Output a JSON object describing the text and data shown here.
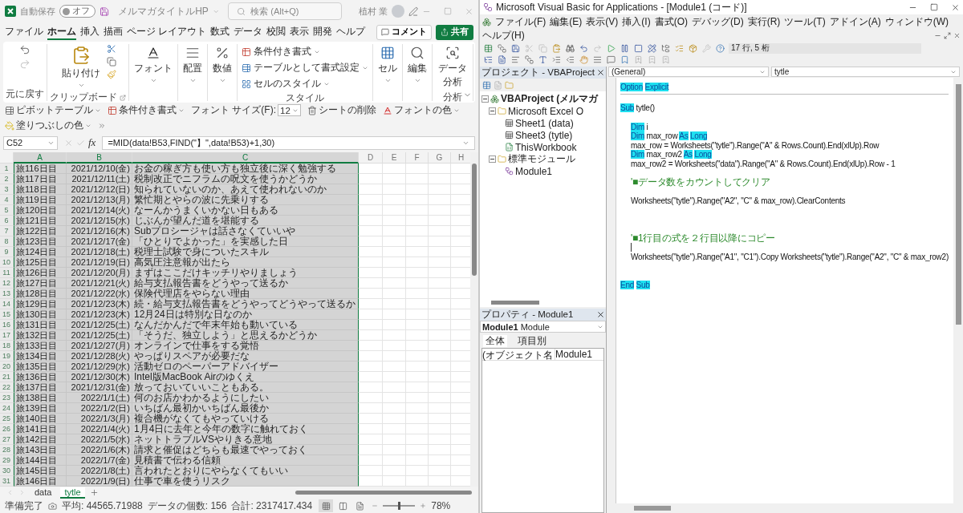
{
  "excel": {
    "title_bar": {
      "autosave_label": "自動保存",
      "autosave_toggle": {
        "label": "オフ",
        "on": false
      },
      "file_name": "メルマガタイトルHP",
      "search": {
        "placeholder": "検索 (Alt+Q)"
      },
      "user_name": "植村 業"
    },
    "ribbon_tabs": [
      {
        "label": "ファイル",
        "selected": false
      },
      {
        "label": "ホーム",
        "selected": true
      },
      {
        "label": "挿入",
        "selected": false
      },
      {
        "label": "描画",
        "selected": false
      },
      {
        "label": "ページ レイアウト",
        "selected": false
      },
      {
        "label": "数式",
        "selected": false
      },
      {
        "label": "データ",
        "selected": false
      },
      {
        "label": "校閲",
        "selected": false
      },
      {
        "label": "表示",
        "selected": false
      },
      {
        "label": "開発",
        "selected": false
      },
      {
        "label": "ヘルプ",
        "selected": false
      }
    ],
    "comment_button": "コメント",
    "share_button": "共有",
    "ribbon_groups": [
      {
        "kind": "undo",
        "caption": "元に戻す"
      },
      {
        "kind": "clipboard",
        "label": "貼り付け",
        "caption": "クリップボード"
      },
      {
        "kind": "font",
        "label": "フォント"
      },
      {
        "kind": "alignment",
        "label": "配置"
      },
      {
        "kind": "number",
        "label": "数値"
      },
      {
        "kind": "styles",
        "items": [
          "条件付き書式",
          "テーブルとして書式設定",
          "セルのスタイル"
        ],
        "caption": "スタイル"
      },
      {
        "kind": "cells",
        "label": "セル"
      },
      {
        "kind": "editing",
        "label": "編集"
      },
      {
        "kind": "analysis",
        "label": "データ分析",
        "caption": "分析"
      }
    ],
    "quick_bar": [
      {
        "kind": "pivot",
        "label": "ピボットテーブル",
        "dropdown": true
      },
      {
        "kind": "conditional",
        "label": "条件付き書式",
        "dropdown": true
      },
      {
        "kind": "font_size",
        "label": "フォント サイズ(F):",
        "value": "12",
        "dropdown": true
      },
      {
        "kind": "delete_sheet",
        "label": "シートの削除",
        "dropdown": false
      },
      {
        "kind": "font_color",
        "label": "フォントの色",
        "dropdown": true
      },
      {
        "kind": "fill_color",
        "label": "塗りつぶしの色",
        "dropdown": true
      }
    ],
    "formula_bar": {
      "name_box": "C52",
      "fx_label": "fx",
      "formula": "=MID(data!B53,FIND(\"】\",data!B53)+1,30)"
    },
    "columns": [
      {
        "label": "A",
        "selected": true
      },
      {
        "label": "B",
        "selected": true
      },
      {
        "label": "C",
        "selected": true
      },
      {
        "label": "D",
        "selected": false
      },
      {
        "label": "E",
        "selected": false
      },
      {
        "label": "F",
        "selected": false
      },
      {
        "label": "G",
        "selected": false
      },
      {
        "label": "H",
        "selected": false
      }
    ],
    "rows": [
      {
        "number": "1",
        "a": "旅116日目",
        "b": "2021/12/10(金)",
        "c": "お金の稼ぎ方も使い方も独立後に深く勉強する"
      },
      {
        "number": "2",
        "a": "旅117日目",
        "b": "2021/12/11(土)",
        "c": "税制改正でニフラムの呪文を使うかどうか"
      },
      {
        "number": "3",
        "a": "旅118日目",
        "b": "2021/12/12(日)",
        "c": "知られていないのか、あえて使われないのか"
      },
      {
        "number": "4",
        "a": "旅119日目",
        "b": "2021/12/13(月)",
        "c": "繁忙期とやらの波に先乗りする"
      },
      {
        "number": "5",
        "a": "旅120日目",
        "b": "2021/12/14(火)",
        "c": "なーんかうまくいかない日もある"
      },
      {
        "number": "6",
        "a": "旅121日目",
        "b": "2021/12/15(水)",
        "c": "じぶんが望んだ道を堪能する"
      },
      {
        "number": "7",
        "a": "旅122日目",
        "b": "2021/12/16(木)",
        "c": "Subプロシージャは話さなくていいや"
      },
      {
        "number": "8",
        "a": "旅123日目",
        "b": "2021/12/17(金)",
        "c": "「ひとりでよかった」を実感した日"
      },
      {
        "number": "9",
        "a": "旅124日目",
        "b": "2021/12/18(土)",
        "c": "税理士試験で身についたスキル"
      },
      {
        "number": "10",
        "a": "旅125日目",
        "b": "2021/12/19(日)",
        "c": "高気圧注意報が出たら"
      },
      {
        "number": "11",
        "a": "旅126日目",
        "b": "2021/12/20(月)",
        "c": "まずはここだけキッチリやりましょう"
      },
      {
        "number": "12",
        "a": "旅127日目",
        "b": "2021/12/21(火)",
        "c": "給与支払報告書をどうやって送るか"
      },
      {
        "number": "13",
        "a": "旅128日目",
        "b": "2021/12/22(水)",
        "c": "保険代理店をやらない理由"
      },
      {
        "number": "14",
        "a": "旅129日目",
        "b": "2021/12/23(木)",
        "c": "続・給与支払報告書をどうやってどうやって送るか"
      },
      {
        "number": "15",
        "a": "旅130日目",
        "b": "2021/12/23(木)",
        "c": "12月24日は特別な日なのか"
      },
      {
        "number": "16",
        "a": "旅131日目",
        "b": "2021/12/25(土)",
        "c": "なんだかんだで年末年始も動いている"
      },
      {
        "number": "17",
        "a": "旅132日目",
        "b": "2021/12/25(土)",
        "c": "「そうだ、独立しよう」と思えるかどうか"
      },
      {
        "number": "18",
        "a": "旅133日目",
        "b": "2021/12/27(月)",
        "c": "オンラインで仕事をする覚悟"
      },
      {
        "number": "19",
        "a": "旅134日目",
        "b": "2021/12/28(火)",
        "c": "やっぱりスペアが必要だな"
      },
      {
        "number": "20",
        "a": "旅135日目",
        "b": "2021/12/29(水)",
        "c": "活動ゼロのペーパーアドバイザー"
      },
      {
        "number": "21",
        "a": "旅136日目",
        "b": "2021/12/30(木)",
        "c": "Intel版MacBook Airのゆくえ"
      },
      {
        "number": "22",
        "a": "旅137日目",
        "b": "2021/12/31(金)",
        "c": "放っておいていいこともある。"
      },
      {
        "number": "23",
        "a": "旅138日目",
        "b": "2022/1/1(土)",
        "c": "何のお店かわかるようにしたい"
      },
      {
        "number": "24",
        "a": "旅139日目",
        "b": "2022/1/2(日)",
        "c": "いちばん最初かいちばん最後か"
      },
      {
        "number": "25",
        "a": "旅140日目",
        "b": "2022/1/3(月)",
        "c": "複合機がなくてもやっていける"
      },
      {
        "number": "26",
        "a": "旅141日目",
        "b": "2022/1/4(火)",
        "c": "1月4日に去年と今年の数字に触れておく"
      },
      {
        "number": "27",
        "a": "旅142日目",
        "b": "2022/1/5(水)",
        "c": "ネットトラブルVSやりきる意地"
      },
      {
        "number": "28",
        "a": "旅143日目",
        "b": "2022/1/6(木)",
        "c": "請求と催促はどちらも最速でやっておく"
      },
      {
        "number": "29",
        "a": "旅144日目",
        "b": "2022/1/7(金)",
        "c": "見積書で伝わる信頼"
      },
      {
        "number": "30",
        "a": "旅145日目",
        "b": "2022/1/8(土)",
        "c": "言われたとおりにやらなくてもいい"
      },
      {
        "number": "31",
        "a": "旅146日目",
        "b": "2022/1/9(日)",
        "c": "仕事で車を使うリスク"
      }
    ],
    "sheet_tabs": [
      {
        "label": "data",
        "selected": false
      },
      {
        "label": "tytle",
        "selected": true
      }
    ],
    "status_bar": {
      "ready": "準備完了",
      "average": "平均: 44565.71988",
      "count": "データの個数: 156",
      "sum": "合計: 2317417.434",
      "view_modes": [
        {
          "kind": "normal",
          "selected": true
        },
        {
          "kind": "page_layout",
          "selected": false
        },
        {
          "kind": "page_break",
          "selected": false
        }
      ],
      "zoom": {
        "level": 0.5,
        "reading": "78%"
      }
    }
  },
  "vba": {
    "title": "Microsoft Visual Basic for Applications - [Module1 (コード)]",
    "menu": [
      "ファイル(F)",
      "編集(E)",
      "表示(V)",
      "挿入(I)",
      "書式(O)",
      "デバッグ(D)",
      "実行(R)",
      "ツール(T)",
      "アドイン(A)",
      "ウィンドウ(W)",
      "ヘルプ(H)"
    ],
    "position": "17 行, 5 桁",
    "project_pane": {
      "title": "プロジェクト - VBAProject",
      "tree": [
        {
          "label": "VBAProject (メルマガ",
          "kind": "project",
          "expanded": true,
          "children": [
            {
              "label": "Microsoft Excel O",
              "kind": "folder",
              "expanded": true,
              "children": [
                {
                  "label": "Sheet1 (data)",
                  "kind": "sheet"
                },
                {
                  "label": "Sheet3 (tytle)",
                  "kind": "sheet"
                },
                {
                  "label": "ThisWorkbook",
                  "kind": "workbook"
                }
              ]
            },
            {
              "label": "標準モジュール",
              "kind": "folder",
              "expanded": true,
              "children": [
                {
                  "label": "Module1",
                  "kind": "module"
                }
              ]
            }
          ]
        }
      ]
    },
    "properties_pane": {
      "title": "プロパティ - Module1",
      "object": "**Module1** Module",
      "tabs": [
        {
          "label": "全体",
          "selected": true
        },
        {
          "label": "項目別",
          "selected": false
        }
      ],
      "rows": [
        {
          "name": "(オブジェクト名",
          "value": "Module1"
        }
      ]
    },
    "code": {
      "object_dropdown": "(General)",
      "procedure_dropdown": "tytle",
      "lines": [
        {
          "kind": "code",
          "indented": false,
          "separator_below": true,
          "segments": [
            {
              "kind": "keyword",
              "text": "Option Explicit"
            }
          ]
        },
        {
          "kind": "blank"
        },
        {
          "kind": "code",
          "indented": false,
          "segments": [
            {
              "kind": "keyword",
              "text": "Sub"
            },
            {
              "kind": "plain",
              "text": " tytle()"
            }
          ]
        },
        {
          "kind": "blank"
        },
        {
          "kind": "code",
          "indented": true,
          "segments": [
            {
              "kind": "keyword",
              "text": "Dim"
            },
            {
              "kind": "plain",
              "text": " i"
            }
          ]
        },
        {
          "kind": "code",
          "indented": true,
          "segments": [
            {
              "kind": "keyword",
              "text": "Dim"
            },
            {
              "kind": "plain",
              "text": " max_row "
            },
            {
              "kind": "keyword",
              "text": "As Long"
            }
          ]
        },
        {
          "kind": "code",
          "indented": true,
          "segments": [
            {
              "kind": "plain",
              "text": "max_row = Worksheets(\"tytle\").Range(\"A\" & Rows.Count).End(xlUp).Row"
            }
          ]
        },
        {
          "kind": "code",
          "indented": true,
          "segments": [
            {
              "kind": "keyword",
              "text": "Dim"
            },
            {
              "kind": "plain",
              "text": " max_row2 "
            },
            {
              "kind": "keyword",
              "text": "As Long"
            }
          ]
        },
        {
          "kind": "code",
          "indented": true,
          "segments": [
            {
              "kind": "plain",
              "text": "max_row2 = Worksheets(\"data\").Range(\"A\" & Rows.Count).End(xlUp).Row - 1"
            }
          ]
        },
        {
          "kind": "blank"
        },
        {
          "kind": "code",
          "indented": true,
          "segments": [
            {
              "kind": "comment",
              "text": "'■データ数をカウントしてクリア"
            }
          ]
        },
        {
          "kind": "blank"
        },
        {
          "kind": "code",
          "indented": true,
          "segments": [
            {
              "kind": "plain",
              "text": "Worksheets(\"tytle\").Range(\"A2\", \"C\" & max_row).ClearContents"
            }
          ]
        },
        {
          "kind": "blank"
        },
        {
          "kind": "blank"
        },
        {
          "kind": "blank"
        },
        {
          "kind": "code",
          "indented": true,
          "segments": [
            {
              "kind": "comment",
              "text": "'■1行目の式を２行目以降にコピー"
            }
          ]
        },
        {
          "kind": "caret"
        },
        {
          "kind": "code",
          "indented": true,
          "segments": [
            {
              "kind": "plain",
              "text": "Worksheets(\"tytle\").Range(\"A1\", \"C1\").Copy Worksheets(\"tytle\").Range(\"A2\", \"C\" & max_row2)"
            }
          ]
        },
        {
          "kind": "blank"
        },
        {
          "kind": "blank"
        },
        {
          "kind": "code",
          "indented": false,
          "segments": [
            {
              "kind": "keyword",
              "text": "End Sub"
            }
          ]
        }
      ]
    }
  }
}
